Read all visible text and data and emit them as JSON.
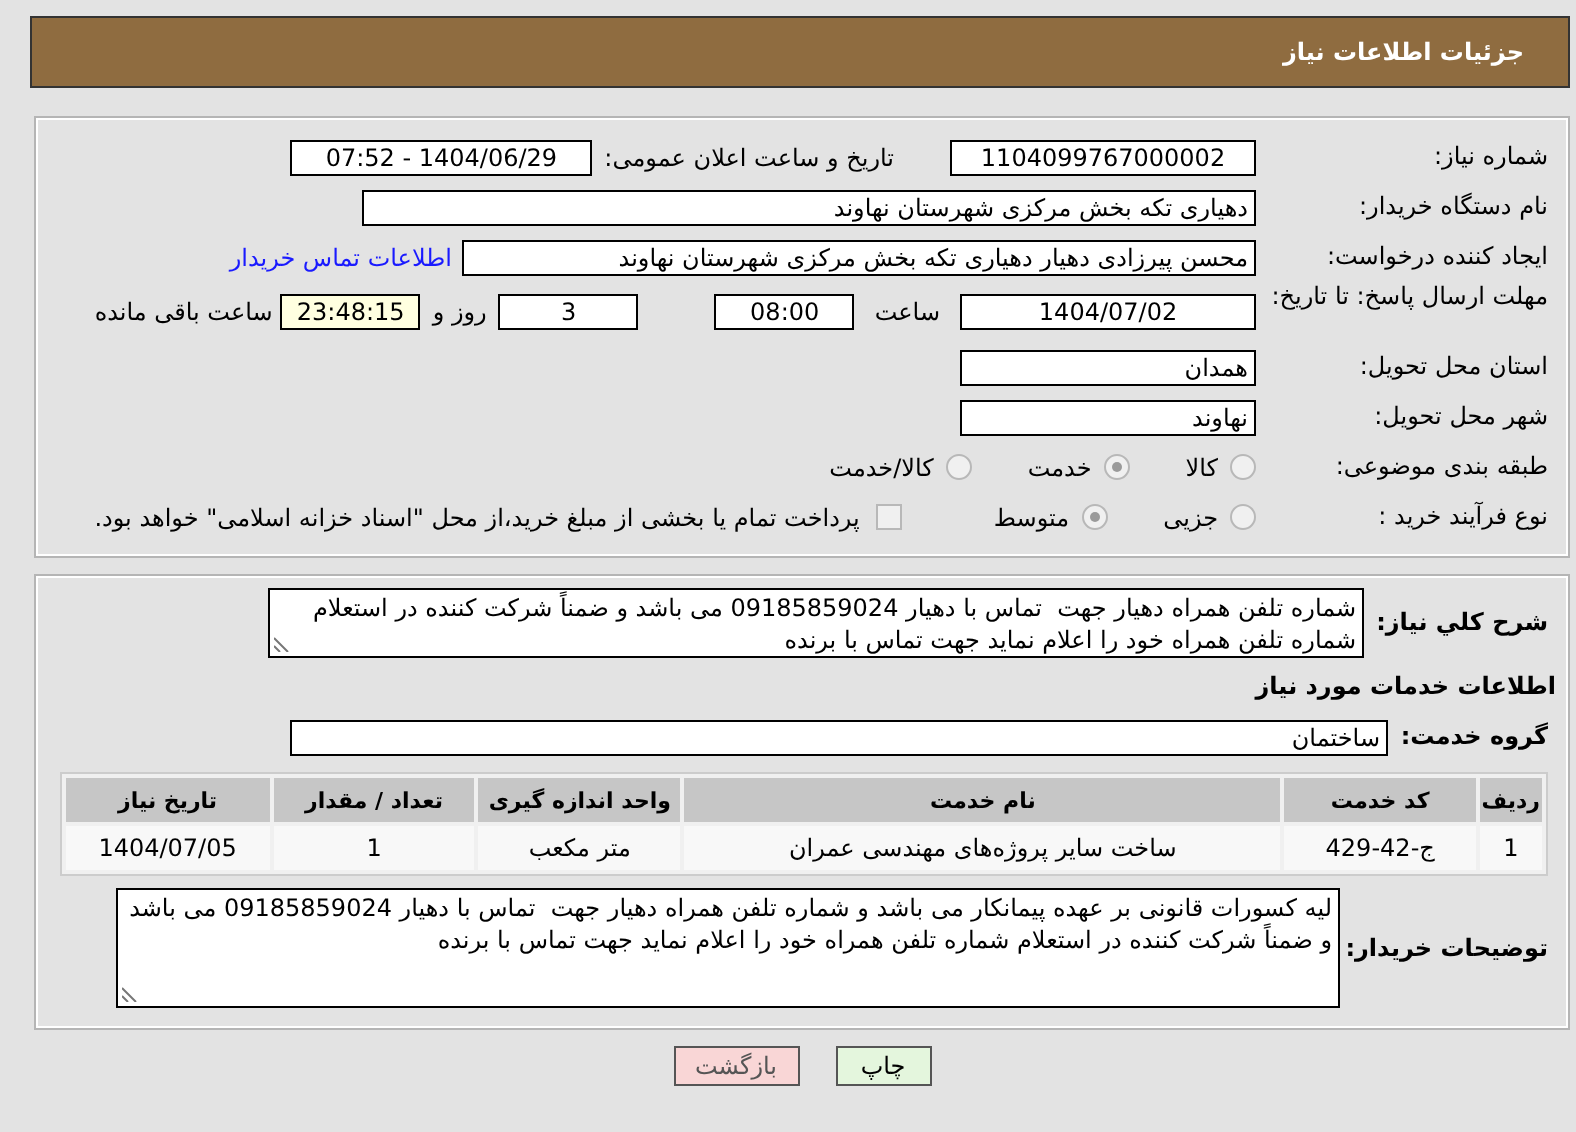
{
  "header": {
    "title": "جزئیات اطلاعات نیاز"
  },
  "details": {
    "need_number": {
      "label": "شماره نیاز:",
      "value": "1104099767000002"
    },
    "announce": {
      "label": "تاریخ و ساعت اعلان عمومی:",
      "value": "1404/06/29 - 07:52"
    },
    "buyer_org": {
      "label": "نام دستگاه خریدار:",
      "value": "دهیاری تکه بخش مرکزی شهرستان نهاوند"
    },
    "requester": {
      "label": "ایجاد کننده درخواست:",
      "value": "محسن پیرزادی دهیار دهیاری تکه بخش مرکزی شهرستان نهاوند",
      "link": "اطلاعات تماس خریدار"
    },
    "deadline": {
      "label": "مهلت ارسال پاسخ: تا تاریخ:",
      "date": "1404/07/02",
      "time_label": "ساعت",
      "time": "08:00",
      "days": "3",
      "days_label": "روز و",
      "remaining": "23:48:15",
      "remaining_label": "ساعت باقی مانده"
    },
    "province": {
      "label": "استان محل تحویل:",
      "value": "همدان"
    },
    "city": {
      "label": "شهر محل تحویل:",
      "value": "نهاوند"
    },
    "category": {
      "label": "طبقه بندی موضوعی:",
      "options": [
        {
          "label": "کالا",
          "selected": false
        },
        {
          "label": "خدمت",
          "selected": true
        },
        {
          "label": "کالا/خدمت",
          "selected": false
        }
      ]
    },
    "process": {
      "label": "نوع فرآیند خرید :",
      "options": [
        {
          "label": "جزیی",
          "selected": false
        },
        {
          "label": "متوسط",
          "selected": true
        }
      ],
      "payment": {
        "label": "پرداخت تمام یا بخشی از مبلغ خرید،از محل \"اسناد خزانه اسلامی\" خواهد بود.",
        "checked": false
      }
    }
  },
  "needs": {
    "description": {
      "label": "شرح كلي نیاز:",
      "value": "شماره تلفن همراه دهیار جهت  تماس با دهیار 09185859024 می باشد و ضمناً شرکت کننده در استعلام شماره تلفن همراه خود را اعلام نماید جهت تماس با برنده"
    },
    "section_title": "اطلاعات خدمات مورد نیاز",
    "service_group": {
      "label": "گروه خدمت:",
      "value": "ساختمان"
    },
    "table": {
      "columns": [
        "ردیف",
        "کد خدمت",
        "نام خدمت",
        "واحد اندازه گیری",
        "تعداد / مقدار",
        "تاریخ نیاز"
      ],
      "rows": [
        [
          "1",
          "ج-42-429",
          "ساخت سایر پروژه‌های مهندسی عمران",
          "متر مکعب",
          "1",
          "1404/07/05"
        ]
      ]
    },
    "buyer_notes": {
      "label": "توضیحات خریدار:",
      "value": "لیه کسورات قانونی بر عهده پیمانکار می باشد و شماره تلفن همراه دهیار جهت  تماس با دهیار 09185859024 می باشد و ضمناً شرکت کننده در استعلام شماره تلفن همراه خود را اعلام نماید جهت تماس با برنده"
    }
  },
  "buttons": [
    {
      "label": "چاپ",
      "kind": "print"
    },
    {
      "label": "بازگشت",
      "kind": "back"
    }
  ]
}
